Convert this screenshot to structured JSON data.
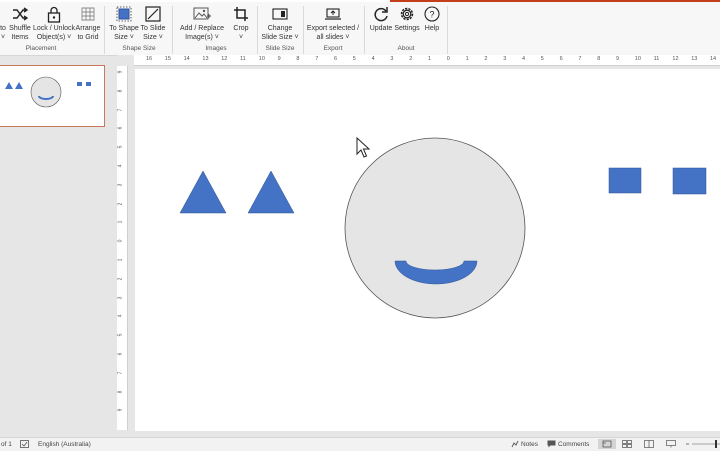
{
  "ribbon": {
    "buttons": [
      {
        "label": "to",
        "sub": "˅"
      },
      {
        "label": "Shuffle",
        "sub": "Items"
      },
      {
        "label": "Lock / Unlock",
        "sub": "Object(s) ˅"
      },
      {
        "label": "Arrange",
        "sub": "to Grid"
      },
      {
        "label": "To Shape",
        "sub": "Size ˅"
      },
      {
        "label": "To Slide",
        "sub": "Size ˅"
      },
      {
        "label": "Add / Replace",
        "sub": "Image(s) ˅"
      },
      {
        "label": "Crop",
        "sub": "˅"
      },
      {
        "label": "Change",
        "sub": "Slide Size ˅"
      },
      {
        "label": "Export selected /",
        "sub": "all slides ˅"
      },
      {
        "label": "Update",
        "sub": ""
      },
      {
        "label": "Settings",
        "sub": ""
      },
      {
        "label": "Help",
        "sub": ""
      }
    ],
    "groups": [
      "Placement",
      "Shape Size",
      "Images",
      "Slide Size",
      "Export",
      "About"
    ]
  },
  "ruler": {
    "horizontal": [
      "16",
      "15",
      "14",
      "13",
      "12",
      "11",
      "10",
      "9",
      "8",
      "7",
      "6",
      "5",
      "4",
      "3",
      "2",
      "1",
      "0",
      "1",
      "2",
      "3",
      "4",
      "5",
      "6",
      "7",
      "8",
      "9",
      "10",
      "11",
      "12",
      "13",
      "14"
    ],
    "vertical": [
      "9",
      "8",
      "7",
      "6",
      "5",
      "4",
      "3",
      "2",
      "1",
      "0",
      "1",
      "2",
      "3",
      "4",
      "5",
      "6",
      "7",
      "8",
      "9"
    ]
  },
  "status": {
    "slide_of": "of 1",
    "language": "English (Australia)",
    "notes": "Notes",
    "comments": "Comments"
  },
  "colors": {
    "shape_blue": "#4472c4",
    "face_gray": "#e5e5e5",
    "accent_red": "#c43e1c"
  }
}
